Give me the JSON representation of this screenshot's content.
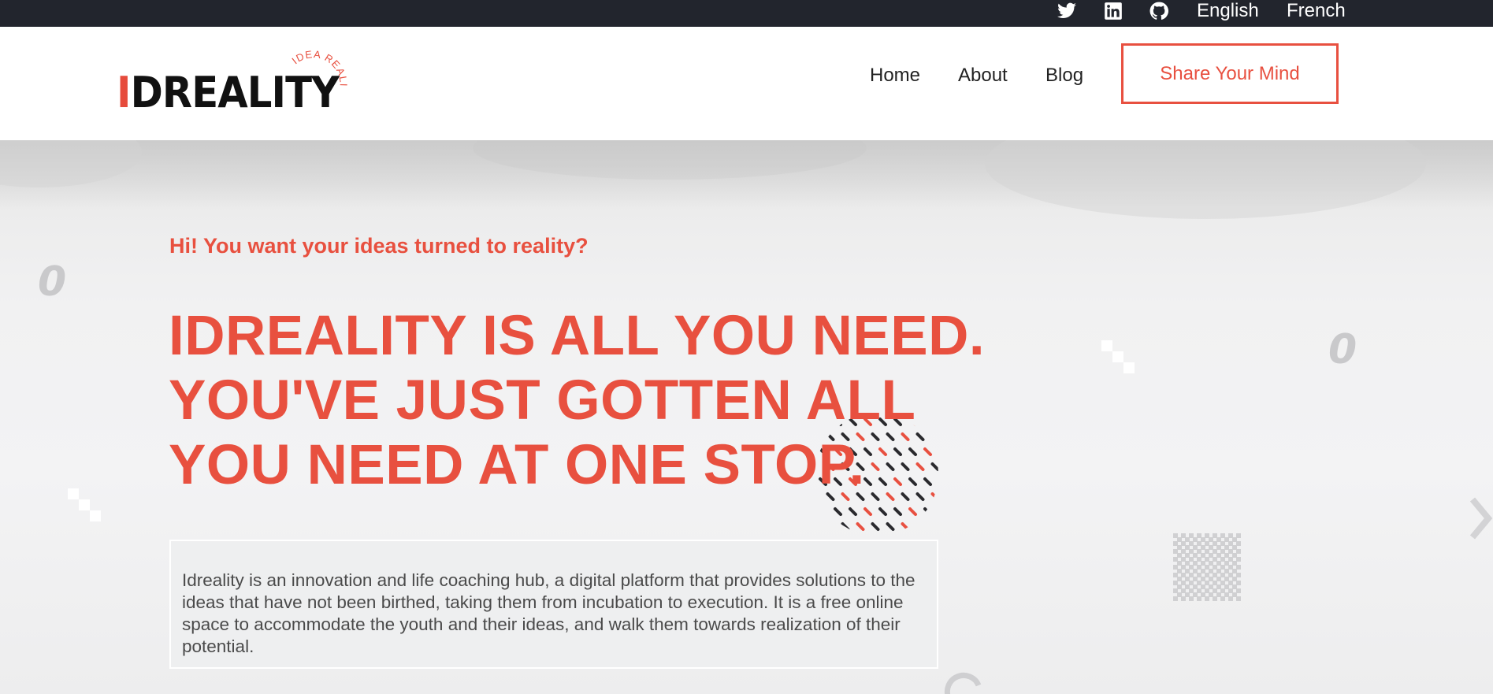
{
  "topbar": {
    "social": [
      {
        "icon": "twitter-icon"
      },
      {
        "icon": "linkedin-icon"
      },
      {
        "icon": "github-icon"
      }
    ],
    "languages": [
      "English",
      "French"
    ]
  },
  "header": {
    "logo": {
      "wordmark": "IDREALITY",
      "tagline": "IDEA REALITY"
    },
    "nav": [
      "Home",
      "About",
      "Blog"
    ],
    "cta_label": "Share Your Mind"
  },
  "hero": {
    "eyebrow": "Hi! You want your ideas turned to reality?",
    "headline_lines": [
      "IDREALITY IS ALL YOU NEED.",
      "YOU'VE JUST GOTTEN ALL",
      "YOU NEED AT ONE STOP."
    ],
    "description": "Idreality is an innovation and life coaching hub, a digital platform that provides solutions to the ideas that have not been birthed, taking them from incubation to execution. It is a free online space to accommodate the youth and their ideas, and walk them towards realization of their potential."
  },
  "colors": {
    "accent": "#e8503f",
    "topbar_bg": "#22252d",
    "text_dark": "#222222"
  }
}
